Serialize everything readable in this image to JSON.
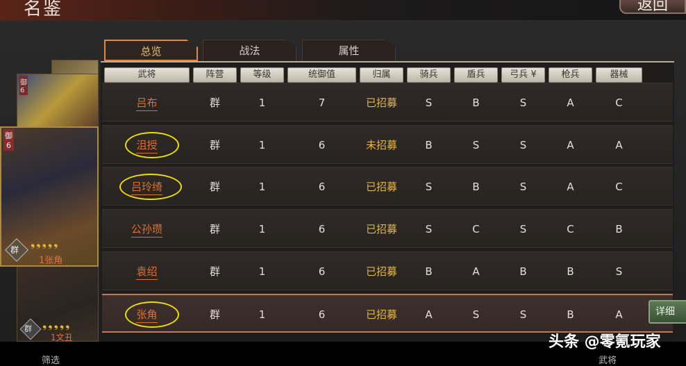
{
  "title": "名鉴",
  "back_label": "返回",
  "tabs": [
    {
      "label": "总览"
    },
    {
      "label": "战法"
    },
    {
      "label": "属性"
    }
  ],
  "headers": [
    "武将",
    "阵营",
    "等级",
    "统御值",
    "归属",
    "骑兵",
    "盾兵",
    "弓兵",
    "枪兵",
    "器械"
  ],
  "sort_icon": "double-chevron-down-icon",
  "rows": [
    {
      "name": "吕布",
      "camp": "群",
      "level": "1",
      "cost": "7",
      "status": "已招募",
      "cav": "S",
      "shield": "B",
      "bow": "S",
      "spear": "A",
      "siege": "C"
    },
    {
      "name": "沮授",
      "camp": "群",
      "level": "1",
      "cost": "6",
      "status": "未招募",
      "cav": "B",
      "shield": "S",
      "bow": "S",
      "spear": "A",
      "siege": "A"
    },
    {
      "name": "吕玲绮",
      "camp": "群",
      "level": "1",
      "cost": "6",
      "status": "已招募",
      "cav": "S",
      "shield": "B",
      "bow": "S",
      "spear": "A",
      "siege": "C"
    },
    {
      "name": "公孙瓒",
      "camp": "群",
      "level": "1",
      "cost": "6",
      "status": "已招募",
      "cav": "S",
      "shield": "C",
      "bow": "S",
      "spear": "C",
      "siege": "B"
    },
    {
      "name": "袁绍",
      "camp": "群",
      "level": "1",
      "cost": "6",
      "status": "已招募",
      "cav": "B",
      "shield": "A",
      "bow": "B",
      "spear": "B",
      "siege": "S"
    },
    {
      "name": "张角",
      "camp": "群",
      "level": "1",
      "cost": "6",
      "status": "已招募",
      "cav": "A",
      "shield": "S",
      "bow": "S",
      "spear": "B",
      "siege": "A"
    }
  ],
  "cards": [
    {
      "badge": "御",
      "cost": "6",
      "camp": "群",
      "label": "1张角"
    },
    {
      "badge": "御",
      "cost": "6"
    },
    {
      "camp": "群",
      "label": "1文丑"
    }
  ],
  "detail_label": "详细",
  "bottom": {
    "filter": "筛选",
    "generals": "武将"
  },
  "watermark": "头条 @零氪玩家",
  "colors": {
    "accent": "#e38a3a",
    "name": "#e0702e",
    "recruited": "#e1b64a",
    "highlight_ring": "#f0e000"
  }
}
